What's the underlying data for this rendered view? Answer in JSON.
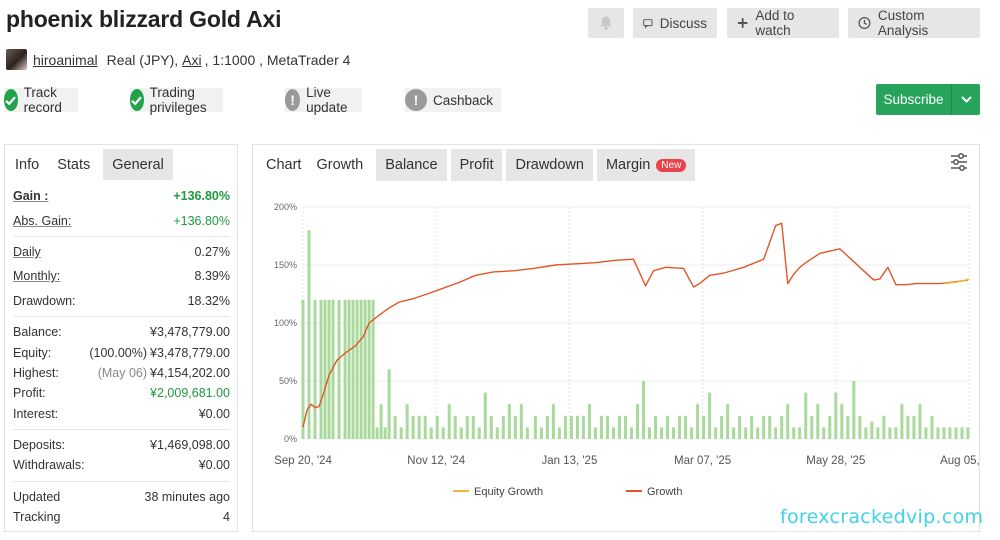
{
  "header": {
    "title": "phoenix blizzard Gold Axi",
    "buttons": {
      "discuss": "Discuss",
      "watch": "Add to watch",
      "analysis": "Custom Analysis"
    }
  },
  "owner": {
    "username": "hiroanimal",
    "account_prefix": "Real (JPY),",
    "broker": "Axi",
    "account_suffix": ", 1:1000 , MetaTrader 4"
  },
  "badges": [
    {
      "label": "Track record",
      "status": "ok"
    },
    {
      "label": "Trading privileges",
      "status": "ok"
    },
    {
      "label": "Live update",
      "status": "warn"
    },
    {
      "label": "Cashback",
      "status": "warn"
    }
  ],
  "subscribe": {
    "label": "Subscribe"
  },
  "left_tabs": {
    "info": "Info",
    "stats": "Stats",
    "general": "General"
  },
  "stats": {
    "gain": {
      "label": "Gain :",
      "value": "+136.80%"
    },
    "abs_gain": {
      "label": "Abs. Gain:",
      "value": "+136.80%"
    },
    "daily": {
      "label": "Daily",
      "value": "0.27%"
    },
    "monthly": {
      "label": "Monthly:",
      "value": "8.39%"
    },
    "drawdown": {
      "label": "Drawdown:",
      "value": "18.32%"
    },
    "balance": {
      "label": "Balance:",
      "value": "¥3,478,779.00"
    },
    "equity": {
      "label": "Equity:",
      "note": "(100.00%)",
      "value": "¥3,478,779.00"
    },
    "highest": {
      "label": "Highest:",
      "note": "(May 06)",
      "value": "¥4,154,202.00"
    },
    "profit": {
      "label": "Profit:",
      "value": "¥2,009,681.00"
    },
    "interest": {
      "label": "Interest:",
      "value": "¥0.00"
    },
    "deposits": {
      "label": "Deposits:",
      "value": "¥1,469,098.00"
    },
    "withdrawals": {
      "label": "Withdrawals:",
      "value": "¥0.00"
    },
    "updated": {
      "label": "Updated",
      "value": "38 minutes ago"
    },
    "tracking": {
      "label": "Tracking",
      "value": "4"
    }
  },
  "chart_tabs": {
    "chart": "Chart",
    "growth": "Growth",
    "balance": "Balance",
    "profit": "Profit",
    "drawdown": "Drawdown",
    "margin": "Margin",
    "new_badge": "New"
  },
  "watermark": "forexcrackedvip.com",
  "colors": {
    "growth": "#e0562a",
    "equity_growth": "#f2b43a",
    "bars": "#a9d99b",
    "green": "#27a35b"
  },
  "chart_data": {
    "type": "line",
    "y_ticks": [
      "0%",
      "50%",
      "100%",
      "150%",
      "200%"
    ],
    "ylim": [
      0,
      200
    ],
    "x_ticks": [
      "Sep 20, '24",
      "Nov 12, '24",
      "Jan 13, '25",
      "Mar 07, '25",
      "May 28, '25",
      "Aug 05, '25"
    ],
    "xlim": [
      0,
      665
    ],
    "legend": [
      "Equity Growth",
      "Growth"
    ],
    "series": [
      {
        "name": "Growth",
        "x": [
          0,
          4,
          8,
          12,
          16,
          20,
          26,
          34,
          42,
          52,
          60,
          66,
          72,
          78,
          86,
          96,
          110,
          124,
          140,
          156,
          172,
          190,
          210,
          230,
          252,
          272,
          292,
          312,
          330,
          342,
          350,
          362,
          380,
          390,
          396,
          406,
          420,
          440,
          460,
          472,
          478,
          484,
          490,
          496,
          502,
          516,
          536,
          556,
          570,
          576,
          584,
          592,
          602,
          612,
          626,
          636,
          646,
          656,
          664
        ],
        "y": [
          10,
          25,
          30,
          27,
          28,
          38,
          55,
          68,
          74,
          80,
          88,
          100,
          104,
          108,
          113,
          118,
          121,
          125,
          130,
          135,
          141,
          144,
          145,
          147,
          150,
          151,
          152,
          154,
          155,
          132,
          145,
          148,
          147,
          131,
          134,
          141,
          143,
          148,
          155,
          184,
          186,
          134,
          142,
          148,
          152,
          160,
          164,
          148,
          137,
          138,
          148,
          133,
          133,
          134,
          134,
          134,
          135,
          136,
          137
        ]
      },
      {
        "name": "Equity Growth",
        "x": [
          640,
          650,
          658,
          665
        ],
        "y": [
          134,
          135,
          136,
          138
        ]
      }
    ],
    "bars": {
      "x": [
        0,
        6,
        12,
        18,
        22,
        26,
        30,
        36,
        42,
        46,
        50,
        54,
        58,
        62,
        66,
        70,
        74,
        78,
        82,
        86,
        92,
        98,
        104,
        110,
        116,
        122,
        128,
        134,
        140,
        146,
        152,
        158,
        164,
        170,
        176,
        182,
        188,
        194,
        200,
        206,
        212,
        218,
        224,
        232,
        238,
        244,
        250,
        256,
        262,
        268,
        274,
        280,
        286,
        292,
        298,
        304,
        310,
        316,
        322,
        328,
        334,
        340,
        346,
        352,
        358,
        364,
        370,
        376,
        382,
        388,
        394,
        400,
        406,
        412,
        418,
        424,
        430,
        436,
        442,
        448,
        454,
        460,
        466,
        472,
        478,
        484,
        490,
        496,
        502,
        508,
        514,
        520,
        526,
        532,
        538,
        544,
        550,
        556,
        562,
        568,
        574,
        580,
        586,
        592,
        598,
        604,
        610,
        616,
        622,
        628,
        634,
        640,
        646,
        652,
        658,
        664
      ],
      "y": [
        120,
        180,
        120,
        120,
        120,
        120,
        120,
        120,
        120,
        120,
        120,
        120,
        120,
        120,
        120,
        120,
        10,
        30,
        10,
        60,
        20,
        10,
        30,
        20,
        20,
        20,
        10,
        20,
        10,
        30,
        20,
        10,
        20,
        20,
        10,
        40,
        20,
        10,
        20,
        30,
        20,
        30,
        10,
        20,
        10,
        20,
        30,
        10,
        20,
        20,
        20,
        20,
        30,
        10,
        20,
        20,
        10,
        20,
        20,
        10,
        30,
        50,
        10,
        20,
        10,
        20,
        10,
        20,
        20,
        10,
        30,
        20,
        40,
        10,
        20,
        30,
        10,
        20,
        10,
        20,
        10,
        20,
        20,
        10,
        20,
        30,
        10,
        10,
        40,
        20,
        30,
        10,
        20,
        40,
        30,
        20,
        50,
        20,
        10,
        15,
        10,
        20,
        10,
        10,
        30,
        20,
        20,
        30,
        10,
        20,
        10,
        10,
        10,
        10,
        10,
        10
      ]
    },
    "grid": true
  }
}
